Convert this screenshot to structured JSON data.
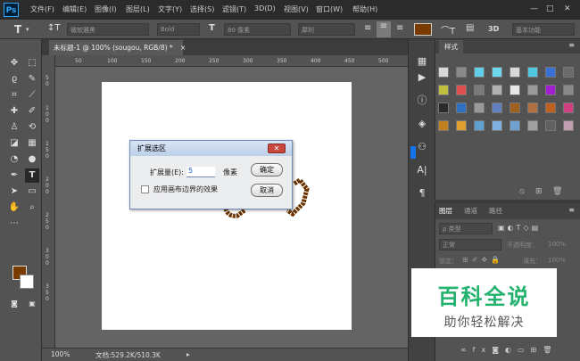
{
  "app": {
    "logo": "Ps"
  },
  "menu": [
    "文件(F)",
    "编辑(E)",
    "图像(I)",
    "图层(L)",
    "文字(Y)",
    "选择(S)",
    "滤镜(T)",
    "3D(D)",
    "视图(V)",
    "窗口(W)",
    "帮助(H)"
  ],
  "window_controls": {
    "minimize": "—",
    "restore": "□",
    "close": "✕"
  },
  "options": {
    "font_family": "微软雅黑",
    "font_style": "Bold",
    "font_size": "80 像素",
    "antialias": "犀利",
    "text_color": "#7a3b00",
    "three_d": "3D",
    "workspace": "基本功能"
  },
  "document": {
    "tab_title": "未标题-1 @ 100% (sougou, RGB/8) *",
    "tab_close": "×"
  },
  "ruler_h": [
    "50",
    "100",
    "150",
    "200",
    "250",
    "300",
    "350",
    "400",
    "450",
    "500"
  ],
  "ruler_v": [
    "5",
    "0",
    "1",
    "0",
    "0",
    "1",
    "5",
    "0",
    "2",
    "0",
    "0",
    "2",
    "5",
    "0",
    "3",
    "0",
    "0",
    "3",
    "5",
    "0"
  ],
  "status": {
    "zoom": "100%",
    "doc_info": "文档:529.2K/510.3K"
  },
  "colors": {
    "foreground": "#7a3b00",
    "background": "#ffffff"
  },
  "styles_panel": {
    "tab": "样式"
  },
  "layers_panel": {
    "tabs": [
      "图层",
      "通道",
      "路径"
    ],
    "filter": "ρ 类型",
    "blend_mode": "正常",
    "opacity_label": "不透明度：",
    "opacity_value": "100%",
    "lock_label": "锁定：",
    "fill_label": "填充：",
    "fill_value": "100%"
  },
  "dialog": {
    "title": "扩展选区",
    "close": "✕",
    "expand_label": "扩展量(E):",
    "expand_value": "5",
    "unit": "像素",
    "checkbox_label": "应用画布边界的效果",
    "ok": "确定",
    "cancel": "取消"
  },
  "watermark": {
    "title": "百科全说",
    "subtitle": "助你轻松解决"
  }
}
